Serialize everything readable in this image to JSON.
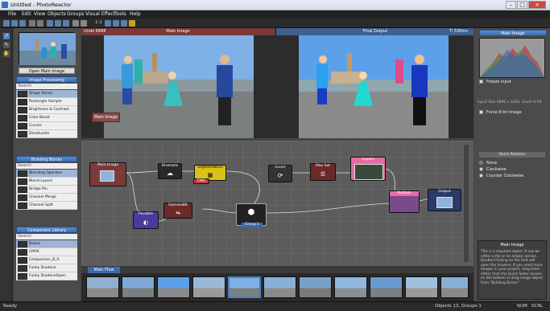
{
  "window": {
    "title": "Untitled - PhotoReactor",
    "min": "–",
    "max": "□",
    "close": "×"
  },
  "menu": [
    "File",
    "Edit",
    "View",
    "Objects",
    "Groups",
    "Visual Effect",
    "Tools",
    "Help"
  ],
  "toolbar": {
    "zoom": "1:1"
  },
  "left": {
    "open_button": "Open Main Image",
    "sections": [
      {
        "title": "Image Processing",
        "search": "Search",
        "items": [
          "Shape Sense",
          "Rectangle Sample",
          "Brightness & Contrast",
          "Color Boost",
          "Curves",
          "Desaturate"
        ],
        "selected": 0
      },
      {
        "title": "Building Blocks",
        "search": "Search",
        "items": [
          "Blending Operator",
          "Blend Layers",
          "Bridge Pin",
          "Channel Merge",
          "Channel Split"
        ],
        "selected": 0
      },
      {
        "title": "Component Library",
        "search": "Search",
        "items": [
          "Basics",
          "CMYK",
          "Comparison_B_A",
          "Funky Duotone",
          "Funky DuotoneOpen"
        ],
        "selected": 0
      }
    ]
  },
  "viewer": {
    "left_label": "Undo 6848",
    "left_title": "Main Image",
    "right_title": "Final Output",
    "right_info": "T: 530ms",
    "overlay_label": "Main Image"
  },
  "nodes": {
    "main_image": "Main Image",
    "dramatic": "Dramatic",
    "segmentation": "Segmentation",
    "time": "TIME",
    "invert": "Invert",
    "max_sat": "Max Sat",
    "layers": "Layers",
    "multiply": "Multiply",
    "output": "Output",
    "gamma": "GammaBit",
    "possible": "Possible",
    "group": "Group 1"
  },
  "tabs": {
    "main_flow": "Main Flow"
  },
  "right": {
    "header": "Main Image",
    "freeze": "Freeze input",
    "size_info": "Input Size 4896 x 3264, Zoom 0.09",
    "force_colors": "Force 8 bit image",
    "rotation_label": "Quick Rotation",
    "rotation_options": [
      "None",
      "Clockwise",
      "Counter Clockwise"
    ],
    "help_title": "Main Image",
    "help_text": "This is a required object. It can be either a file or an empty canvas. Double-Clicking on the tent will open the browser. If you need more images in your project, drag them either from the Quick folder access on the bottom or drag image object from \"Building Blocks\""
  },
  "status": {
    "left": "Ready",
    "objects": "Objects 13, Groups 1",
    "num": "NUM",
    "scrl": "SCRL"
  },
  "colors": {
    "accent": "#4a7fc4",
    "node_red": "#7a2a2a",
    "node_yellow": "#d8c21a",
    "node_pink": "#e86aa4",
    "node_purple": "#7a4a8a"
  }
}
